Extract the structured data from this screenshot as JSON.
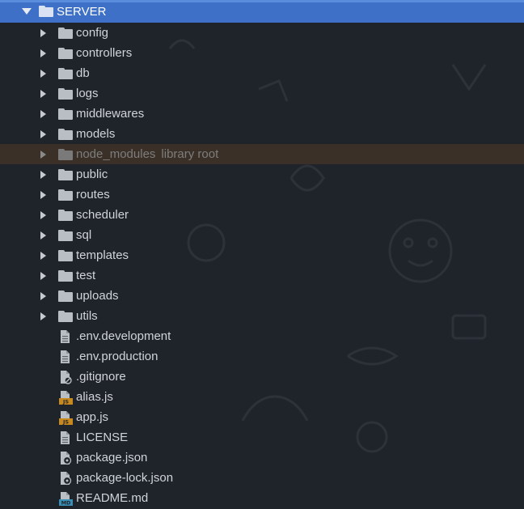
{
  "root": {
    "label": "SERVER"
  },
  "folders": [
    {
      "label": "config"
    },
    {
      "label": "controllers"
    },
    {
      "label": "db"
    },
    {
      "label": "logs"
    },
    {
      "label": "middlewares"
    },
    {
      "label": "models"
    },
    {
      "label": "node_modules",
      "suffix": "library root"
    },
    {
      "label": "public"
    },
    {
      "label": "routes"
    },
    {
      "label": "scheduler"
    },
    {
      "label": "sql"
    },
    {
      "label": "templates"
    },
    {
      "label": "test"
    },
    {
      "label": "uploads"
    },
    {
      "label": "utils"
    }
  ],
  "files": [
    {
      "label": ".env.development",
      "icon": "text-file-icon"
    },
    {
      "label": ".env.production",
      "icon": "text-file-icon"
    },
    {
      "label": ".gitignore",
      "icon": "gitignore-file-icon"
    },
    {
      "label": "alias.js",
      "icon": "js-file-icon",
      "badge": "JS"
    },
    {
      "label": "app.js",
      "icon": "js-file-icon",
      "badge": "JS"
    },
    {
      "label": "LICENSE",
      "icon": "text-file-icon"
    },
    {
      "label": "package.json",
      "icon": "json-file-icon"
    },
    {
      "label": "package-lock.json",
      "icon": "json-file-icon"
    },
    {
      "label": "README.md",
      "icon": "markdown-file-icon",
      "badge": "MD"
    }
  ],
  "colors": {
    "background": "#1f242b",
    "root_selected": "#3d70c6",
    "excluded_row": "#3a3027",
    "text": "#d0d4d9",
    "muted_text": "#7d7d7d",
    "js_badge": "#c8891e",
    "md_badge": "#3a8fb7"
  }
}
